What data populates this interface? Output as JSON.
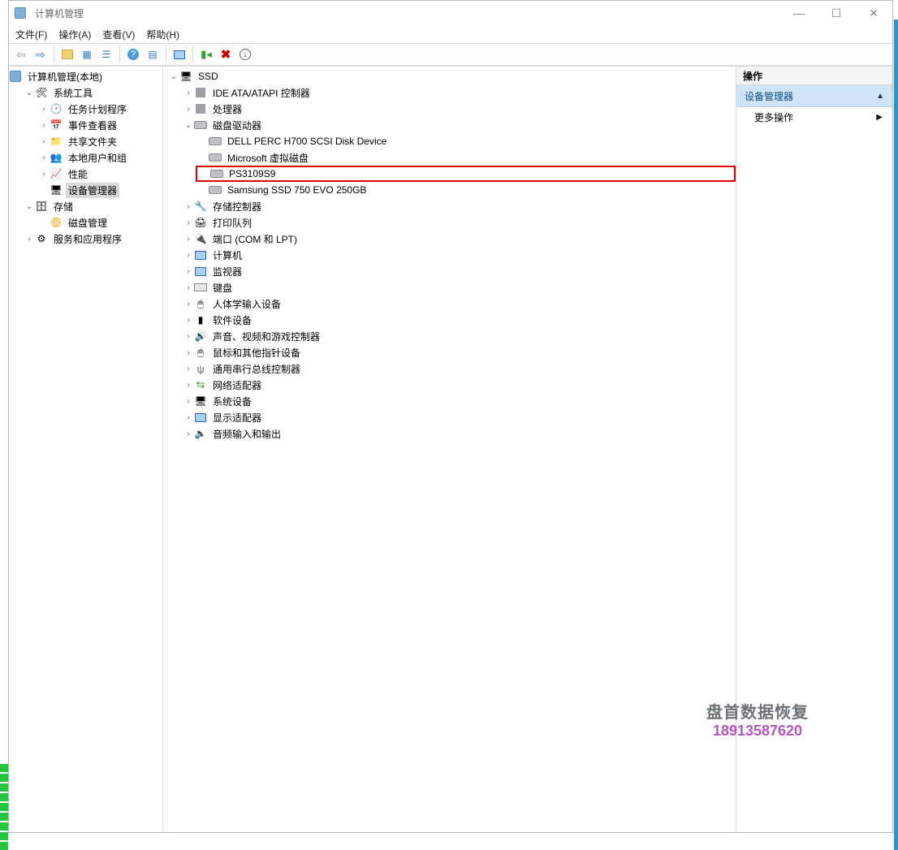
{
  "window": {
    "title": "计算机管理",
    "menu": {
      "file": "文件(F)",
      "action": "操作(A)",
      "view": "查看(V)",
      "help": "帮助(H)"
    },
    "controls": {
      "min": "—",
      "max": "☐",
      "close": "✕"
    }
  },
  "toolbar": {
    "back": "←",
    "forward": "→",
    "up": "⇧",
    "show_tree": "▤",
    "list": "☰",
    "help": "?",
    "properties": "⧉",
    "refresh": "🖥",
    "add": "＋",
    "delete": "✖",
    "scan": "⟳"
  },
  "left_tree": {
    "root": "计算机管理(本地)",
    "system_tools": {
      "label": "系统工具",
      "task_scheduler": "任务计划程序",
      "event_viewer": "事件查看器",
      "shared_folders": "共享文件夹",
      "local_users": "本地用户和组",
      "performance": "性能",
      "device_manager": "设备管理器"
    },
    "storage": {
      "label": "存储",
      "disk_mgmt": "磁盘管理"
    },
    "services": "服务和应用程序"
  },
  "device_tree": {
    "root": "SSD",
    "ide": "IDE ATA/ATAPI 控制器",
    "cpu": "处理器",
    "disk_drives": {
      "label": "磁盘驱动器",
      "d0": "DELL PERC H700 SCSI Disk Device",
      "d1": "Microsoft 虚拟磁盘",
      "d2": "PS3109S9",
      "d3": "Samsung SSD 750 EVO 250GB"
    },
    "storage_ctrl": "存储控制器",
    "print_queues": "打印队列",
    "ports": "端口 (COM 和 LPT)",
    "computer": "计算机",
    "monitors": "监视器",
    "keyboards": "键盘",
    "hid": "人体学输入设备",
    "software_dev": "软件设备",
    "sound": "声音、视频和游戏控制器",
    "mice": "鼠标和其他指针设备",
    "usb": "通用串行总线控制器",
    "network": "网络适配器",
    "system_dev": "系统设备",
    "display": "显示适配器",
    "audio_io": "音频输入和输出"
  },
  "actions": {
    "header": "操作",
    "category": "设备管理器",
    "more": "更多操作"
  },
  "watermark": {
    "line1": "盘首数据恢复",
    "line2": "18913587620"
  }
}
